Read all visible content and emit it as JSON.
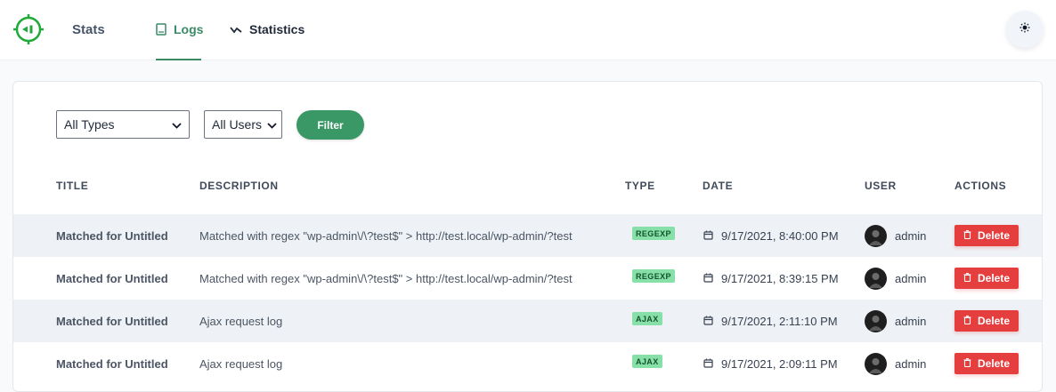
{
  "header": {
    "brand": "Stats",
    "tabs": [
      {
        "label": "Logs",
        "icon": "book-icon",
        "active": true
      },
      {
        "label": "Statistics",
        "icon": "trend-icon",
        "active": false
      }
    ],
    "theme_icon": "sun-icon",
    "accent_color": "#3a8a66"
  },
  "filters": {
    "type_select": "All Types",
    "user_select": "All Users",
    "filter_label": "Filter"
  },
  "table": {
    "columns": [
      "TITLE",
      "DESCRIPTION",
      "TYPE",
      "DATE",
      "USER",
      "ACTIONS"
    ],
    "rows": [
      {
        "title": "Matched for Untitled",
        "description": "Matched with regex \"wp-admin\\/\\?test$\" > http://test.local/wp-admin/?test",
        "type": "REGEXP",
        "date": "9/17/2021, 8:40:00 PM",
        "user": "admin",
        "action": "Delete"
      },
      {
        "title": "Matched for Untitled",
        "description": "Matched with regex \"wp-admin\\/\\?test$\" > http://test.local/wp-admin/?test",
        "type": "REGEXP",
        "date": "9/17/2021, 8:39:15 PM",
        "user": "admin",
        "action": "Delete"
      },
      {
        "title": "Matched for Untitled",
        "description": "Ajax request log",
        "type": "AJAX",
        "date": "9/17/2021, 2:11:10 PM",
        "user": "admin",
        "action": "Delete"
      },
      {
        "title": "Matched for Untitled",
        "description": "Ajax request log",
        "type": "AJAX",
        "date": "9/17/2021, 2:09:11 PM",
        "user": "admin",
        "action": "Delete"
      }
    ]
  },
  "colors": {
    "filter_button": "#3a9866",
    "delete_button": "#e53e3e",
    "badge": "#86e0a8"
  }
}
